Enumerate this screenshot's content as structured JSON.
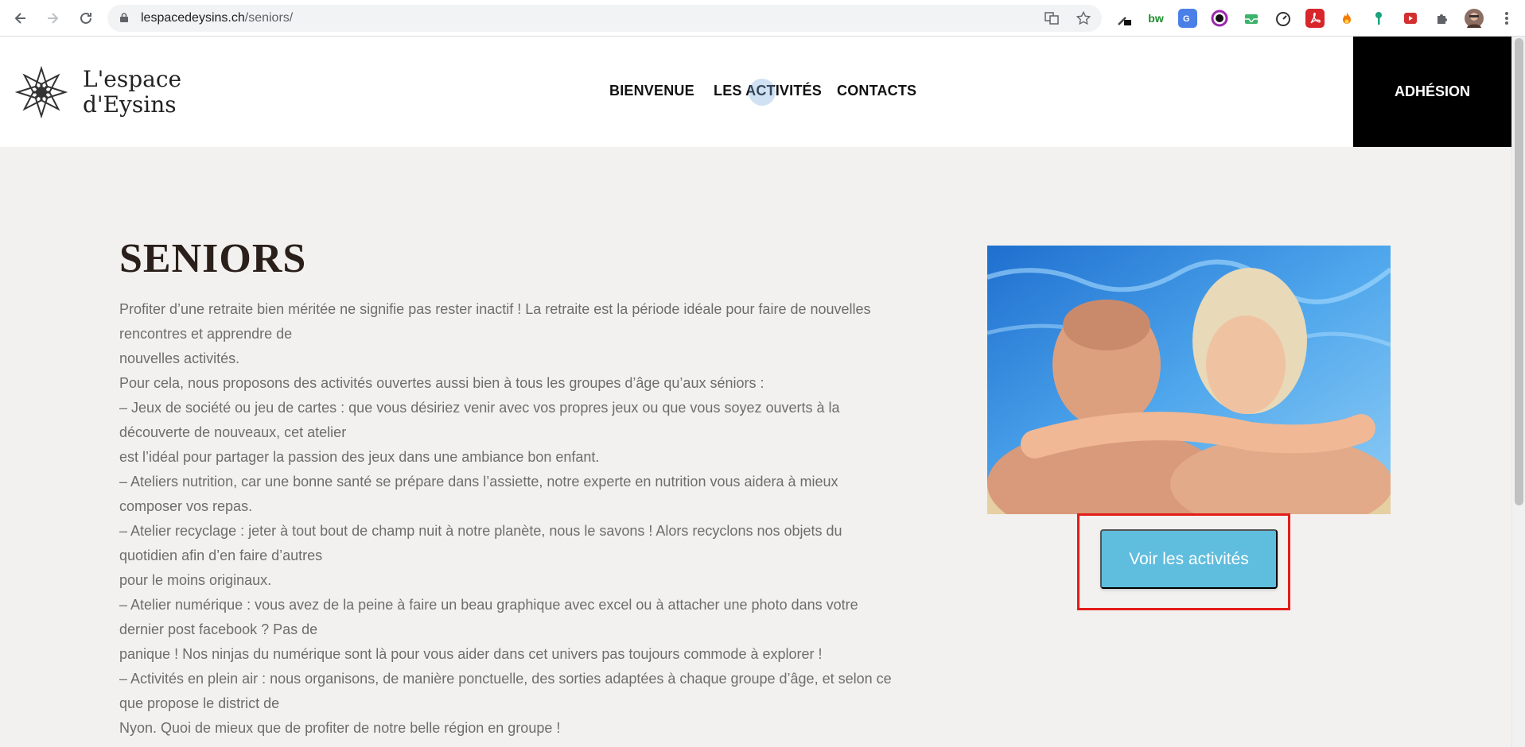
{
  "browser": {
    "url_domain": "lespacedeysins.ch",
    "url_path": "/seniors/",
    "back_icon": "arrow-left-icon",
    "forward_icon": "arrow-right-icon",
    "reload_icon": "reload-icon",
    "ext_bw_label": "bw"
  },
  "site": {
    "logo_line1": "L'espace",
    "logo_line2": "d'Eysins",
    "nav": {
      "bienvenue": "BIENVENUE",
      "activites": "LES ACTIVITÉS",
      "contacts": "CONTACTS"
    },
    "adhesion_label": "ADHÉSION"
  },
  "page": {
    "title": "SENIORS",
    "lines": [
      "Profiter d’une retraite bien méritée ne signifie pas rester inactif ! La retraite est la période idéale pour faire de nouvelles",
      "rencontres et apprendre de",
      "nouvelles activités.",
      "Pour cela, nous proposons des activités ouvertes aussi bien à tous les groupes d’âge qu’aux séniors :",
      "– Jeux de société ou jeu de cartes : que vous désiriez venir avec vos propres jeux ou que vous soyez ouverts à la",
      "découverte de nouveaux, cet atelier",
      "est l’idéal pour partager la passion des jeux dans une ambiance bon enfant.",
      "– Ateliers nutrition, car une bonne santé se prépare dans l’assiette, notre experte en nutrition vous aidera à mieux",
      "composer vos repas.",
      "– Atelier recyclage : jeter à tout bout de champ nuit à notre planète, nous le savons ! Alors recyclons nos objets du",
      "quotidien afin d’en faire d’autres",
      "pour le moins originaux.",
      "– Atelier numérique : vous avez de la peine à faire un beau graphique avec excel ou à attacher une photo dans votre",
      "dernier post facebook ? Pas de",
      "panique ! Nos ninjas du numérique sont là pour vous aider dans cet univers pas toujours commode à explorer !",
      "– Activités en plein air : nous organisons, de manière ponctuelle, des sorties adaptées à chaque groupe d’âge, et selon ce",
      "que propose le district de",
      "Nyon. Quoi de mieux que de profiter de notre belle région en groupe !"
    ],
    "cta_label": "Voir les activités"
  },
  "colors": {
    "accent": "#5fbddd",
    "highlight": "#e41b17",
    "adhesion_bg": "#000000",
    "page_bg": "#f2f1ef"
  }
}
